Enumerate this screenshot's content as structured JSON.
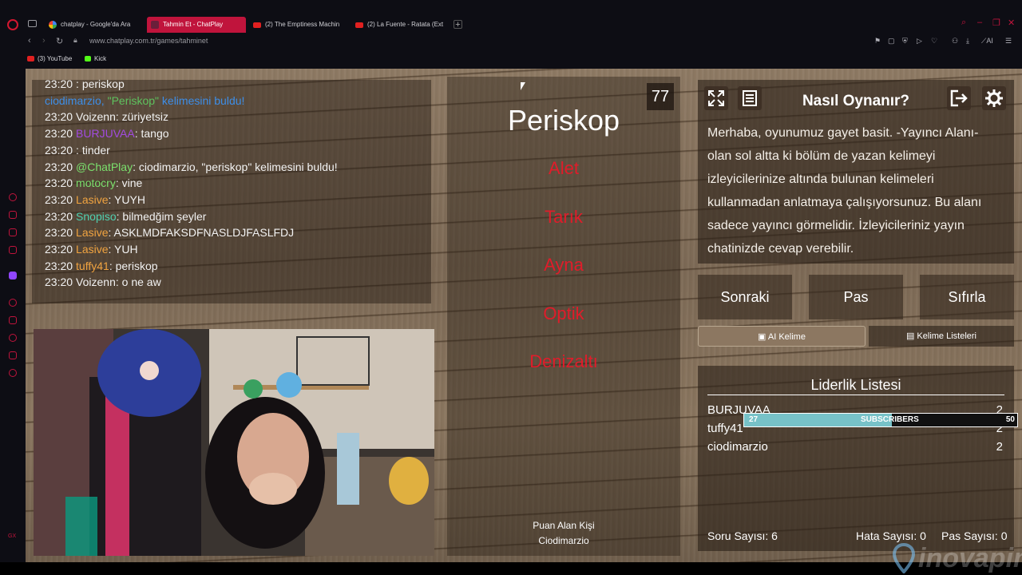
{
  "browser": {
    "tabs": [
      {
        "label": "chatplay - Google'da Ara",
        "active": false
      },
      {
        "label": "Tahmin Et - ChatPlay",
        "active": true
      },
      {
        "label": "(2) The Emptiness Machin",
        "active": false
      },
      {
        "label": "(2) La Fuente - Ratata (Ext",
        "active": false
      }
    ],
    "url": "www.chatplay.com.tr/games/tahminet",
    "ai_label": "AI",
    "bookmarks": [
      {
        "label": "(3) YouTube"
      },
      {
        "label": "Kick"
      }
    ],
    "rail_bottom_label": "GX"
  },
  "chat": [
    {
      "time": "23:20",
      "user": "",
      "message": ": periskop",
      "user_color": "#d01c2a",
      "message_color": "#f2f2f2",
      "sep": ""
    },
    {
      "time": "",
      "user": "ciodimarzio, ",
      "message": "kelimesini buldu!",
      "quoted": "\"Periskop\" ",
      "user_color": "#3d8ee8",
      "message_color": "#3d8ee8",
      "quoted_color": "#5ec25e",
      "sep": ""
    },
    {
      "time": "23:20",
      "user": "Voizenn",
      "message": ": züriyetsiz",
      "user_color": "#f2f2f2",
      "message_color": "#f2f2f2",
      "sep": ""
    },
    {
      "time": "23:20",
      "user": "BURJUVAA",
      "message": ": tango",
      "user_color": "#a24be0",
      "message_color": "#f2f2f2",
      "sep": ""
    },
    {
      "time": "23:20",
      "user": "",
      "message": ": tinder",
      "user_color": "#d01c2a",
      "message_color": "#f2f2f2",
      "sep": ""
    },
    {
      "time": "23:20",
      "user": "@ChatPlay",
      "message": ": ciodimarzio, \"periskop\" kelimesini buldu!",
      "user_color": "#7be06d",
      "message_color": "#f2f2f2",
      "sep": ""
    },
    {
      "time": "23:20",
      "user": "motocry",
      "message": ": vine",
      "user_color": "#7be06d",
      "message_color": "#f2f2f2",
      "sep": ""
    },
    {
      "time": "23:20",
      "user": "Lasive",
      "message": ": YUYH",
      "user_color": "#f0a340",
      "message_color": "#f2f2f2",
      "sep": ""
    },
    {
      "time": "23:20",
      "user": "Snopiso",
      "message": ": bilmedğim şeyler",
      "user_color": "#4fd0b0",
      "message_color": "#f2f2f2",
      "sep": ""
    },
    {
      "time": "23:20",
      "user": "Lasive",
      "message": ": ASKLMDFAKSDFNASLDJFASLFDJ",
      "user_color": "#f0a340",
      "message_color": "#f2f2f2",
      "sep": ""
    },
    {
      "time": "23:20",
      "user": "Lasive",
      "message": ": YUH",
      "user_color": "#f0a340",
      "message_color": "#f2f2f2",
      "sep": ""
    },
    {
      "time": "23:20",
      "user": "tuffy41",
      "message": ": periskop",
      "user_color": "#f0a340",
      "message_color": "#f2f2f2",
      "sep": ""
    },
    {
      "time": "23:20",
      "user": "Voizenn",
      "message": ": o ne aw",
      "user_color": "#f2f2f2",
      "message_color": "#f2f2f2",
      "sep": ""
    }
  ],
  "game": {
    "word": "Periskop",
    "timer": "77",
    "forbidden": [
      "Alet",
      "Tarık",
      "Ayna",
      "Optik",
      "Denizaltı"
    ],
    "scorer_label": "Puan Alan Kişi",
    "scorer_name": "Ciodimarzio"
  },
  "info": {
    "title": "Nasıl Oynanır?",
    "text": "Merhaba, oyunumuz gayet basit. -Yayıncı Alanı- olan sol altta ki bölüm de yazan kelimeyi izleyicilerinize altında bulunan kelimeleri kullanmadan anlatmaya çalışıyorsunuz. Bu alanı sadece yayıncı görmelidir. İzleyicileriniz yayın chatinizde cevap verebilir."
  },
  "actions": {
    "next": "Sonraki",
    "pass": "Pas",
    "reset": "Sıfırla",
    "ai_word": "AI Kelime",
    "word_lists": "Kelime Listeleri"
  },
  "leaderboard": {
    "title": "Liderlik Listesi",
    "rows": [
      {
        "name": "BURJUVAA",
        "score": "2"
      },
      {
        "name": "tuffy41",
        "score": "2"
      },
      {
        "name": "ciodimarzio",
        "score": "2"
      }
    ],
    "questions_label": "Soru Sayısı: 6",
    "errors_label": "Hata Sayısı: 0",
    "passes_label": "Pas Sayısı: 0"
  },
  "subscriber_goal": {
    "current": "27",
    "label": "SUBSCRIBERS",
    "target": "50",
    "progress": 0.54,
    "color": "#77c2c8"
  },
  "watermark": "inovapin",
  "colors": {
    "accent": "#c0143c",
    "forbidden": "#e01c2a"
  }
}
